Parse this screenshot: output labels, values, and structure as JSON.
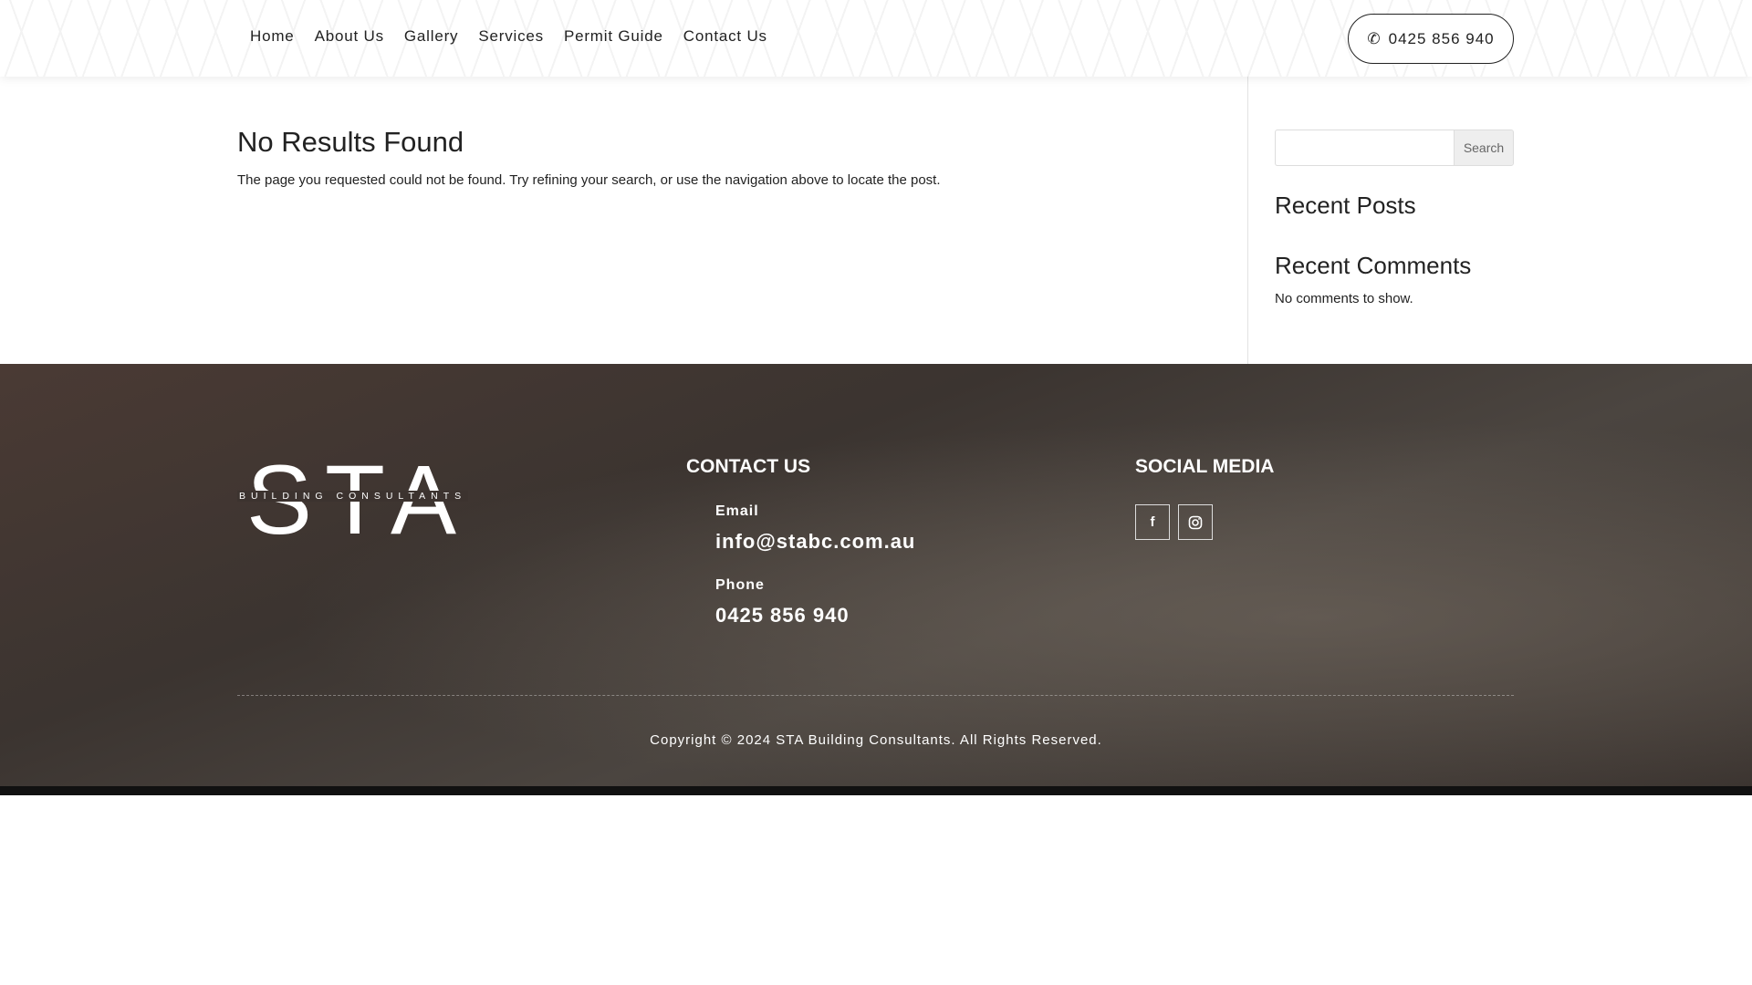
{
  "nav": {
    "items": [
      "Home",
      "About Us",
      "Gallery",
      "Services",
      "Permit Guide",
      "Contact Us"
    ],
    "phone": "0425 856 940"
  },
  "main": {
    "title": "No Results Found",
    "message": "The page you requested could not be found. Try refining your search, or use the navigation above to locate the post."
  },
  "sidebar": {
    "search_button": "Search",
    "search_value": "",
    "recent_posts": "Recent Posts",
    "recent_comments": "Recent Comments",
    "no_comments": "No comments to show."
  },
  "footer": {
    "logo_text": "STA",
    "logo_subtitle": "BUILDING CONSULTANTS",
    "contact_heading": "CONTACT US",
    "email_label": "Email",
    "email": "info@stabc.com.au",
    "phone_label": "Phone",
    "phone": "0425 856 940",
    "social_heading": "SOCIAL MEDIA",
    "social": [
      "facebook-icon",
      "instagram-icon"
    ],
    "copyright": "Copyright © 2024 STA Building Consultants. All Rights Reserved."
  }
}
